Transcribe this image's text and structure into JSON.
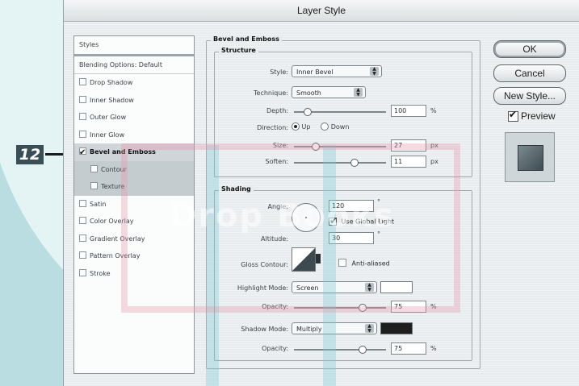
{
  "callout": {
    "number": "12"
  },
  "window": {
    "title": "Layer Style"
  },
  "styles_list": {
    "header": "Styles",
    "blending": "Blending Options: Default",
    "items": [
      {
        "label": "Drop Shadow",
        "checked": false
      },
      {
        "label": "Inner Shadow",
        "checked": false
      },
      {
        "label": "Outer Glow",
        "checked": false
      },
      {
        "label": "Inner Glow",
        "checked": false
      },
      {
        "label": "Bevel and Emboss",
        "checked": true
      },
      {
        "label": "Contour",
        "checked": false
      },
      {
        "label": "Texture",
        "checked": false
      },
      {
        "label": "Satin",
        "checked": false
      },
      {
        "label": "Color Overlay",
        "checked": false
      },
      {
        "label": "Gradient Overlay",
        "checked": false
      },
      {
        "label": "Pattern Overlay",
        "checked": false
      },
      {
        "label": "Stroke",
        "checked": false
      }
    ]
  },
  "bevel": {
    "title": "Bevel and Emboss",
    "structure": {
      "title": "Structure",
      "style_label": "Style:",
      "style_value": "Inner Bevel",
      "technique_label": "Technique:",
      "technique_value": "Smooth",
      "depth_label": "Depth:",
      "depth_value": "100",
      "depth_unit": "%",
      "direction_label": "Direction:",
      "direction_up": "Up",
      "direction_down": "Down",
      "size_label": "Size:",
      "size_value": "27",
      "size_unit": "px",
      "soften_label": "Soften:",
      "soften_value": "11",
      "soften_unit": "px"
    },
    "shading": {
      "title": "Shading",
      "angle_label": "Angle:",
      "angle_value": "120",
      "angle_unit": "°",
      "global_light_label": "Use Global Light",
      "altitude_label": "Altitude:",
      "altitude_value": "30",
      "altitude_unit": "°",
      "gloss_label": "Gloss Contour:",
      "anti_aliased_label": "Anti-aliased",
      "highlight_label": "Highlight Mode:",
      "highlight_value": "Screen",
      "highlight_opacity_label": "Opacity:",
      "highlight_opacity_value": "75",
      "highlight_opacity_unit": "%",
      "shadow_label": "Shadow Mode:",
      "shadow_value": "Multiply",
      "shadow_opacity_label": "Opacity:",
      "shadow_opacity_value": "75",
      "shadow_opacity_unit": "%"
    }
  },
  "buttons": {
    "ok": "OK",
    "cancel": "Cancel",
    "new_style": "New Style...",
    "preview": "Preview"
  },
  "watermark": "Drop Books",
  "colors": {
    "highlight_color": "#ffffff",
    "shadow_color": "#1e1e1e",
    "background": "#b9dde0"
  }
}
